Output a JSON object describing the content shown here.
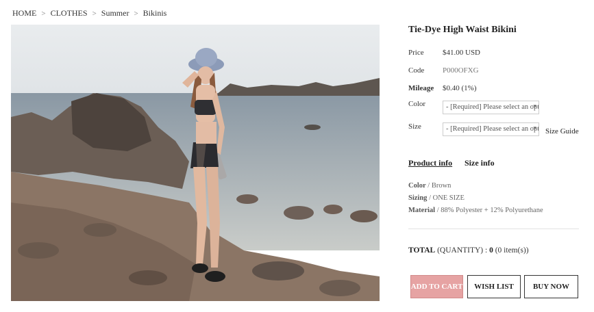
{
  "breadcrumb": [
    "HOME",
    "CLOTHES",
    "Summer",
    "Bikinis"
  ],
  "breadcrumb_separator": ">",
  "product": {
    "title": "Tie-Dye High Waist Bikini",
    "price_label": "Price",
    "price_value": "$41.00 USD",
    "code_label": "Code",
    "code_value": "P000OFXG",
    "mileage_label": "Mileage",
    "mileage_value": "$0.40 (1%)",
    "color_label": "Color",
    "color_select": "- [Required] Please select an opt",
    "size_label": "Size",
    "size_select": "- [Required] Please select an opt",
    "size_guide": "Size Guide"
  },
  "tabs": {
    "product_info": "Product info",
    "size_info": "Size info"
  },
  "details": {
    "color_label": "Color",
    "color_value": "/ Brown",
    "sizing_label": "Sizing",
    "sizing_value": "/ ONE SIZE",
    "material_label": "Material",
    "material_value": "/ 88% Polyester + 12% Polyurethane"
  },
  "total": {
    "label": "TOTAL",
    "quantity_label": "(QUANTITY) :",
    "amount": "0",
    "items": "(0 item(s))"
  },
  "buttons": {
    "add_to_cart": "ADD TO CART",
    "wish_list": "WISH LIST",
    "buy_now": "BUY NOW"
  },
  "colors": {
    "accent": "#e6a3a3",
    "border": "#333333"
  }
}
